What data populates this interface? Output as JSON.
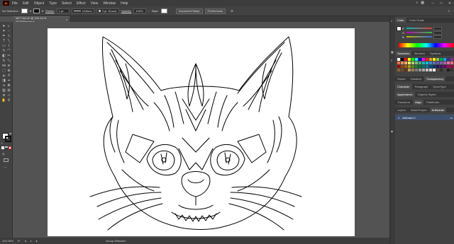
{
  "app": {
    "logo": "Ai"
  },
  "menu": [
    "File",
    "Edit",
    "Object",
    "Type",
    "Select",
    "Effect",
    "View",
    "Window",
    "Help"
  ],
  "window_controls": {
    "minimize": "–",
    "maximize": "□",
    "close": "✕"
  },
  "control_bar": {
    "selection_label": "No Selection",
    "stroke_label": "Stroke:",
    "stroke_weight": "1 pt",
    "uniform_label": "Uniform",
    "brush_label": "3 pt. Round",
    "opacity_label": "Opacity:",
    "opacity_value": "100%",
    "style_label": "Style:",
    "doc_setup": "Document Setup",
    "preferences": "Preferences"
  },
  "doc_tab": {
    "title": "MKT Art.ai* @ 104.16 % (RGB/Preview)",
    "close": "×"
  },
  "status": {
    "zoom": "104.16%",
    "rotation": "0°",
    "artboard": "1",
    "mode": "Group Selection"
  },
  "panels": {
    "color_tabs": [
      "Color",
      "Color Guide"
    ],
    "rgb": {
      "r_label": "R",
      "g_label": "G",
      "b_label": "B",
      "r_color": "#e03a3a",
      "g_color": "#3ac23a",
      "b_color": "#3a6ae0"
    },
    "swatch_tabs": [
      "Swatches",
      "Brushes",
      "Symbols"
    ],
    "stroke_tabs": [
      "Stroke",
      "Gradient",
      "Transparency"
    ],
    "char_tabs": [
      "Character",
      "Paragraph",
      "OpenType"
    ],
    "appearance_tabs": [
      "Appearance",
      "Graphic Styles"
    ],
    "transform_tabs": [
      "Transform",
      "Align",
      "Pathfinder"
    ],
    "layers_tabs": [
      "Layers",
      "Asset Export",
      "Artboards"
    ],
    "artboard_row": {
      "index": "1",
      "name": "Artboard 1"
    }
  },
  "colors": {
    "accent": "#ff9a00",
    "selected_row": "#3d4f6b"
  }
}
